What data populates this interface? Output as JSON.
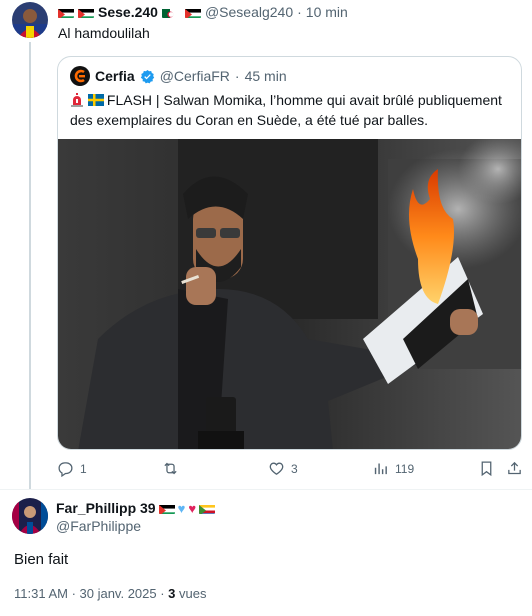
{
  "tweet1": {
    "display_name": "Sese.240",
    "handle": "@Sesealg240",
    "separator": "·",
    "time": "10 min",
    "text": "Al hamdoulilah"
  },
  "quote": {
    "name": "Cerfia",
    "handle": "@CerfiaFR",
    "separator": "·",
    "time": "45 min",
    "text": "FLASH | Salwan Momika, l’homme qui avait brûlé publiquement des exemplaires du Coran en Suède, a été tué par balles."
  },
  "actions": {
    "replies": "1",
    "likes": "3",
    "views": "119"
  },
  "tweet2": {
    "display_name": "Far_Phillipp 39",
    "handle": "@FarPhilippe",
    "text": "Bien fait",
    "timestamp": "11:31 AM · 30 janv. 2025 · ",
    "views_count": "3",
    "views_label": " vues"
  },
  "colors": {
    "text": "#0f1419",
    "muted": "#536471",
    "border": "#cfd9de",
    "verified": "#1d9bf0",
    "brand_orange": "#ff6a00"
  },
  "icons": [
    "reply-icon",
    "retweet-icon",
    "like-icon",
    "views-icon",
    "bookmark-icon",
    "share-icon",
    "verified-icon"
  ]
}
